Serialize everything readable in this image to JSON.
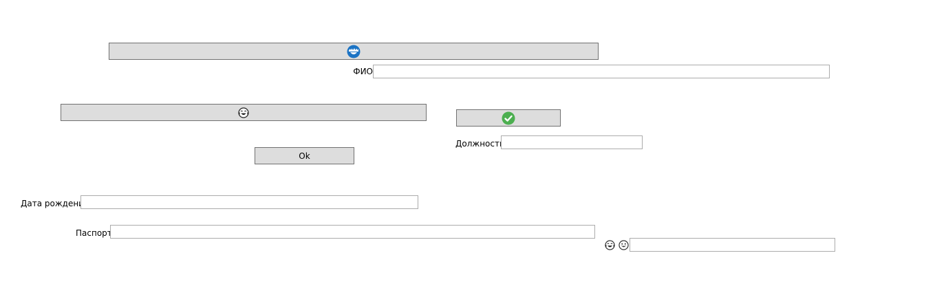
{
  "buttons": {
    "top_icon_button": {
      "icon": "smile-wave-icon",
      "color": "#1b73c4"
    },
    "emoji_button": {
      "icon": "laughing-tears-icon"
    },
    "check_button": {
      "icon": "check-circle-icon",
      "color": "#4caf50"
    },
    "ok_button": {
      "label": "Ok"
    }
  },
  "fields": {
    "fio": {
      "label": "ФИО",
      "value": ""
    },
    "position": {
      "label": "Должность",
      "value": ""
    },
    "birth_date": {
      "label": "Дата рождения",
      "value": ""
    },
    "passport": {
      "label": "Паспорт",
      "value": ""
    },
    "extra": {
      "value": ""
    }
  },
  "emoji_pair": [
    "laughing-tears-icon",
    "grinning-icon"
  ]
}
